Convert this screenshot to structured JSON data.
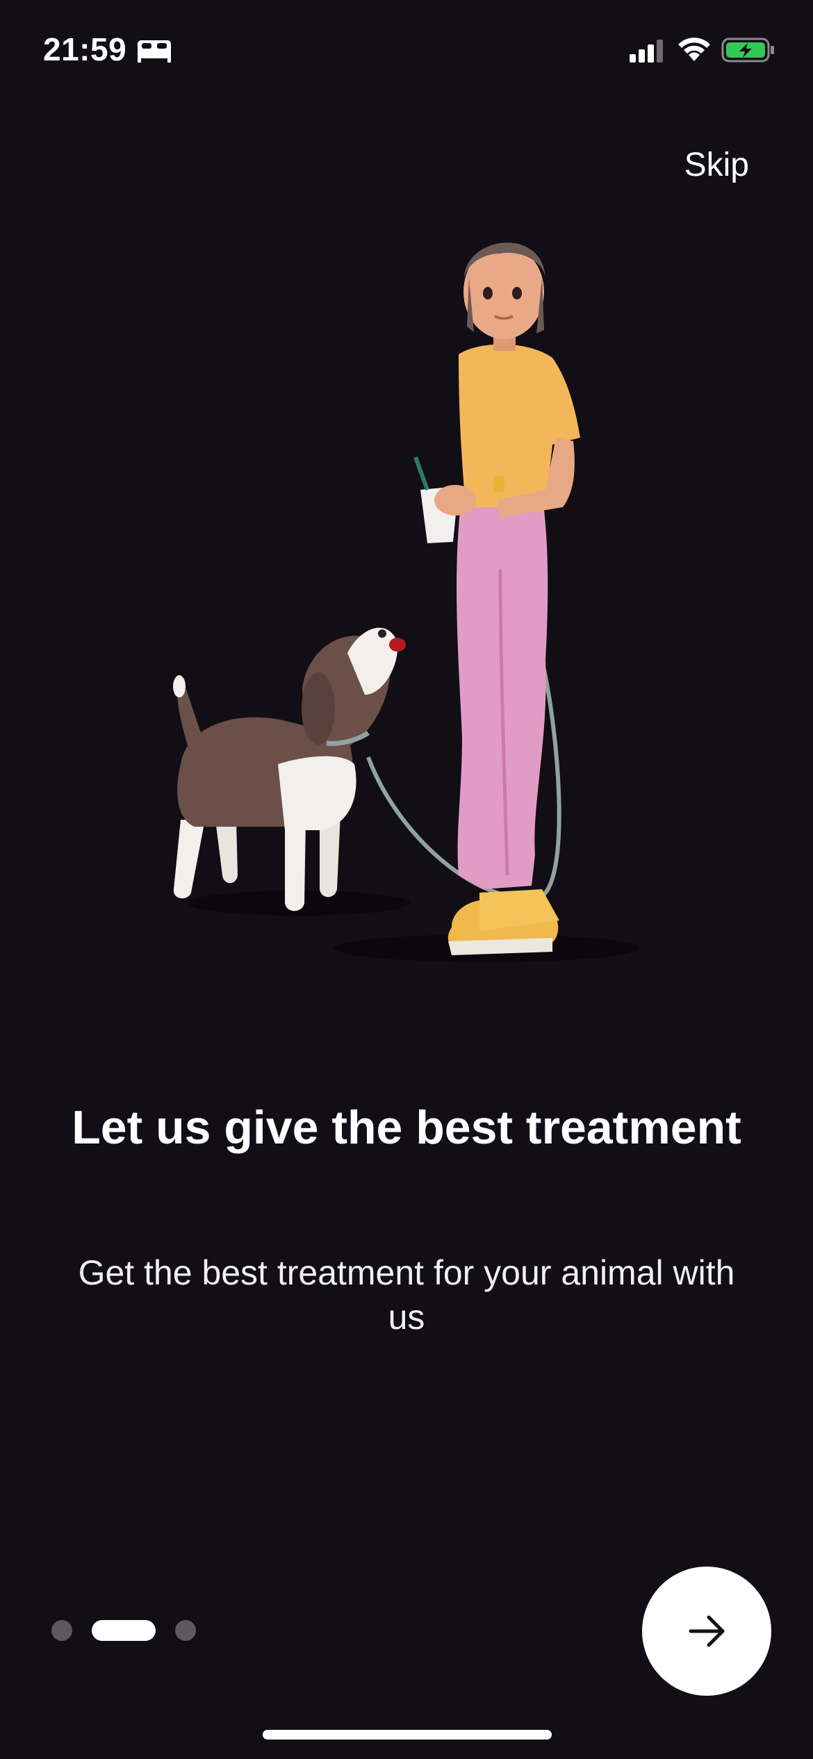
{
  "status_bar": {
    "time": "21:59",
    "icons": [
      "bed-icon",
      "cellular-signal-icon",
      "wifi-icon",
      "battery-charging-icon"
    ],
    "battery_color": "#34c759"
  },
  "header": {
    "skip_label": "Skip"
  },
  "onboarding": {
    "illustration": "woman-walking-dog",
    "title": "Let us give the best treatment",
    "subtitle": "Get the best treatment for your animal with us",
    "pages_total": 3,
    "active_page": 2
  },
  "navigation": {
    "next_icon": "arrow-right-icon"
  },
  "colors": {
    "background": "#120e15",
    "text": "#ffffff",
    "inactive_dot": "#5b5860",
    "active_dot": "#ffffff",
    "button_bg": "#ffffff"
  }
}
